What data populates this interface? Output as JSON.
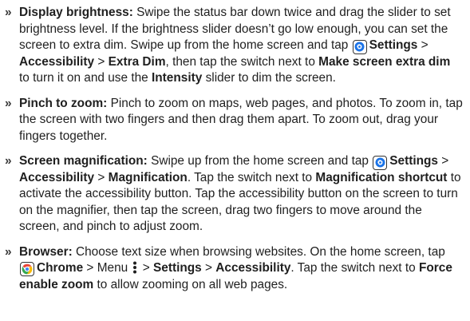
{
  "items": [
    {
      "title": "Display brightness:",
      "t1": " Swipe the status bar down twice and drag the slider to set brightness level. If the brightness slider doesn’t go low enough, you can set the screen to extra dim. Swipe up from the home screen and tap ",
      "settings": "Settings",
      "sep1": " > ",
      "accessibility": "Accessibility",
      "sep2": " > ",
      "extra_dim": "Extra Dim",
      "t2": ", then tap the switch next to ",
      "make_dim": "Make screen extra dim",
      "t3": " to turn it on and use the ",
      "intensity": "Intensity",
      "t4": " slider to dim the screen."
    },
    {
      "title": "Pinch to zoom:",
      "t1": " Pinch to zoom on maps, web pages, and photos. To zoom in, tap the screen with two fingers and then drag them apart. To zoom out, drag your fingers together."
    },
    {
      "title": "Screen magnification:",
      "t1": " Swipe up from the home screen and tap ",
      "settings": "Settings",
      "sep1": " > ",
      "accessibility": "Accessibility",
      "sep2": " > ",
      "magnification": "Magnification",
      "t2": ". Tap the switch next to ",
      "shortcut": "Magnification shortcut",
      "t3": " to activate the accessibility button. Tap the accessibility button on the screen to turn on the magnifier, then tap the screen, drag two fingers to move around the screen, and pinch to adjust zoom."
    },
    {
      "title": "Browser:",
      "t1": " Choose text size when browsing websites. On the home screen, tap ",
      "chrome": "Chrome",
      "t2": " > Menu ",
      "t3": " > ",
      "settings": "Settings",
      "sep1": " > ",
      "accessibility": "Accessibility",
      "t4": ". Tap the switch next to ",
      "force": "Force enable zoom",
      "t5": " to allow zooming on all web pages."
    }
  ],
  "bullet_char": "»",
  "icons": {
    "settings": "settings-gear-icon",
    "chrome": "chrome-icon",
    "menu": "three-dot-menu-icon"
  },
  "colors": {
    "text": "#1f1f1f",
    "settings_icon": "#1a73e8",
    "chrome_red": "#ea4335",
    "chrome_yellow": "#fbbc04",
    "chrome_green": "#34a853",
    "chrome_blue": "#4285f4"
  }
}
